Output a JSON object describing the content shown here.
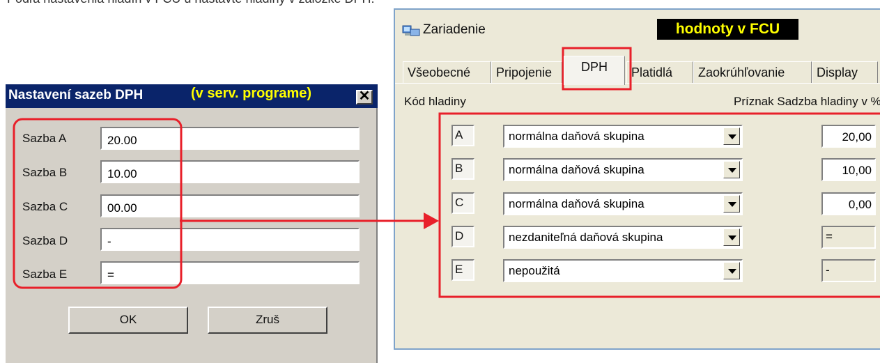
{
  "top_text": "Podľa nastavenia hladín v FCU u nastavte hladiny v záložke DPH:",
  "left_dialog": {
    "title": "Nastavení sazeb DPH",
    "title_note": "(v serv. programe)",
    "close_symbol": "✕",
    "rows": [
      {
        "label": "Sazba A",
        "value": "20.00"
      },
      {
        "label": "Sazba B",
        "value": "10.00"
      },
      {
        "label": "Sazba C",
        "value": "00.00"
      },
      {
        "label": "Sazba D",
        "value": "-"
      },
      {
        "label": "Sazba E",
        "value": "="
      }
    ],
    "ok_label": "OK",
    "cancel_label": "Zruš"
  },
  "right_dialog": {
    "title": "Zariadenie",
    "badge": "hodnoty v FCU",
    "tabs": [
      "Všeobecné",
      "Pripojenie",
      "DPH",
      "Platidlá",
      "Zaokrúhľovanie",
      "Display"
    ],
    "active_tab": "DPH",
    "header_code": "Kód hladiny",
    "header_right": "Príznak  Sadzba hladiny v %",
    "rows": [
      {
        "code": "A",
        "group": "normálna daňová skupina",
        "rate": "20,00"
      },
      {
        "code": "B",
        "group": "normálna daňová skupina",
        "rate": "10,00"
      },
      {
        "code": "C",
        "group": "normálna daňová skupina",
        "rate": "0,00"
      },
      {
        "code": "D",
        "group": "nezdaniteľná daňová skupina",
        "rate": "="
      },
      {
        "code": "E",
        "group": "nepoužitá",
        "rate": "-"
      }
    ]
  },
  "colors": {
    "annotation": "#e8202a",
    "title_bg": "#0a246a",
    "note": "#ffff00"
  }
}
